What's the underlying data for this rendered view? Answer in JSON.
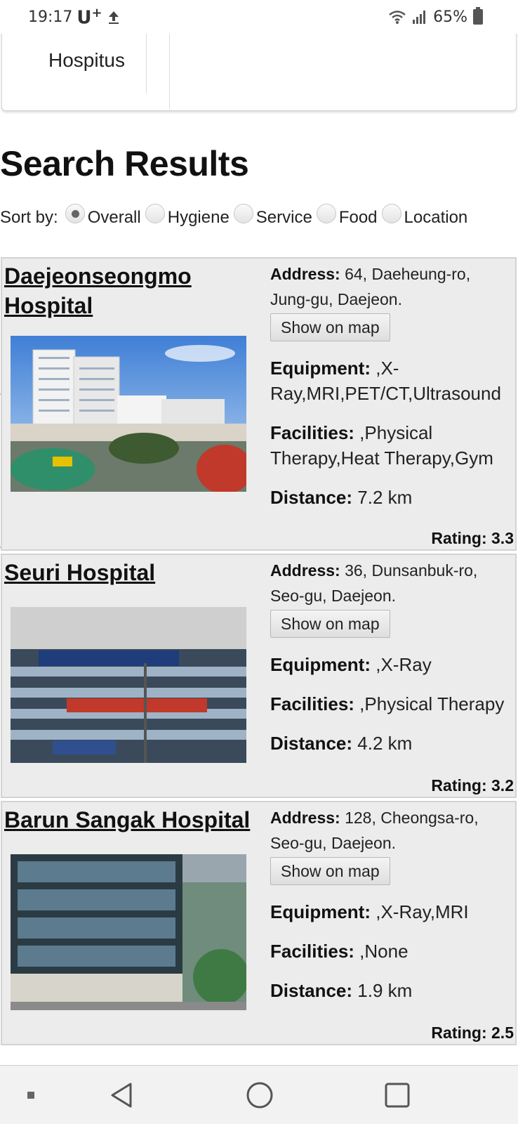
{
  "status_bar": {
    "time": "19:17",
    "carrier": "U",
    "carrier_sup": "+",
    "battery": "65%"
  },
  "nav": {
    "brand": "Hospitus"
  },
  "page_title": "Search Results",
  "sort": {
    "label": "Sort by:",
    "options": [
      "Overall",
      "Hygiene",
      "Service",
      "Food",
      "Location"
    ],
    "selected": "Overall"
  },
  "labels": {
    "address": "Address:",
    "equipment": "Equipment:",
    "facilities": "Facilities:",
    "distance": "Distance:",
    "show_on_map": "Show on map"
  },
  "results": [
    {
      "name": "Daejeonseongmo Hospital",
      "address": "64, Daeheung-ro, Jung-gu, Daejeon.",
      "equipment": ",X-Ray,MRI,PET/CT,Ultrasound",
      "facilities": ",Physical Therapy,Heat Therapy,Gym",
      "distance": "7.2 km",
      "rating": "Rating: 3.3"
    },
    {
      "name": "Seuri Hospital",
      "address": "36, Dunsanbuk-ro, Seo-gu, Daejeon.",
      "equipment": ",X-Ray",
      "facilities": ",Physical Therapy",
      "distance": "4.2 km",
      "rating": "Rating: 3.2"
    },
    {
      "name": "Barun Sangak Hospital",
      "address": "128, Cheongsa-ro, Seo-gu, Daejeon.",
      "equipment": ",X-Ray,MRI",
      "facilities": ",None",
      "distance": "1.9 km",
      "rating": "Rating: 2.5"
    }
  ]
}
